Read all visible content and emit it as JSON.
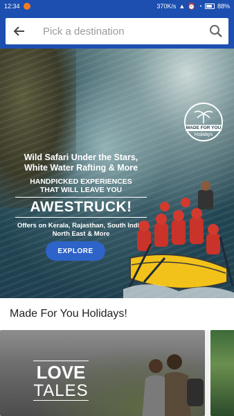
{
  "status_bar": {
    "time": "12:34",
    "network_speed": "370K/s",
    "battery": "88%"
  },
  "search": {
    "placeholder": "Pick a destination"
  },
  "banner": {
    "badge_top": "MADE FOR YOU",
    "badge_bottom": "Holidays",
    "headline_line1": "Wild Safari Under the Stars,",
    "headline_line2": "White Water Rafting & More",
    "sub_line1": "HANDPICKED EXPERIENCES",
    "sub_line2": "THAT WILL LEAVE YOU",
    "awestruck": "AWESTRUCK!",
    "offers_line1": "Offers on Kerala, Rajasthan, South India,",
    "offers_line2": "North East & More",
    "explore_label": "EXPLORE"
  },
  "section": {
    "title": "Made For You Holidays!"
  },
  "cards": [
    {
      "title_line1": "LOVE",
      "title_line2": "TALES"
    }
  ],
  "colors": {
    "primary": "#1c4fb0",
    "button": "#2e63c9",
    "notification": "#f47c20"
  }
}
